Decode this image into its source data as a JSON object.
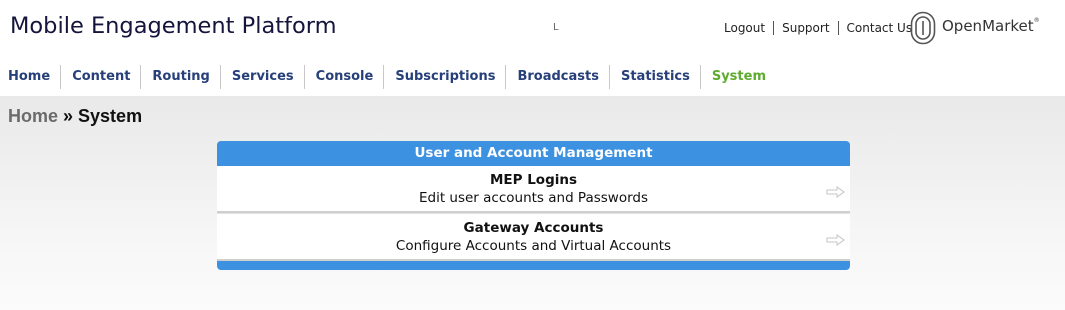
{
  "header": {
    "app_title": "Mobile Engagement Platform",
    "stray_mark": "L",
    "links": {
      "logout": "Logout",
      "support": "Support",
      "contact": "Contact Us"
    },
    "brand": {
      "name": "OpenMarket",
      "trademark": "®",
      "logo_icon": "openmarket-logo-icon"
    }
  },
  "nav": {
    "items": [
      {
        "label": "Home"
      },
      {
        "label": "Content"
      },
      {
        "label": "Routing"
      },
      {
        "label": "Services"
      },
      {
        "label": "Console"
      },
      {
        "label": "Subscriptions"
      },
      {
        "label": "Broadcasts"
      },
      {
        "label": "Statistics"
      },
      {
        "label": "System",
        "active": true
      }
    ],
    "active_color": "#5dab2f",
    "item_color": "#27407a"
  },
  "breadcrumb": {
    "home": "Home",
    "separator": " » ",
    "current": "System"
  },
  "panel": {
    "header": "User and Account Management",
    "accent_color": "#3c91e0",
    "rows": [
      {
        "title": "MEP Logins",
        "description": "Edit user accounts and Passwords",
        "icon": "arrow-right-outline-icon"
      },
      {
        "title": "Gateway Accounts",
        "description": "Configure Accounts and Virtual Accounts",
        "icon": "arrow-right-outline-icon"
      }
    ]
  }
}
